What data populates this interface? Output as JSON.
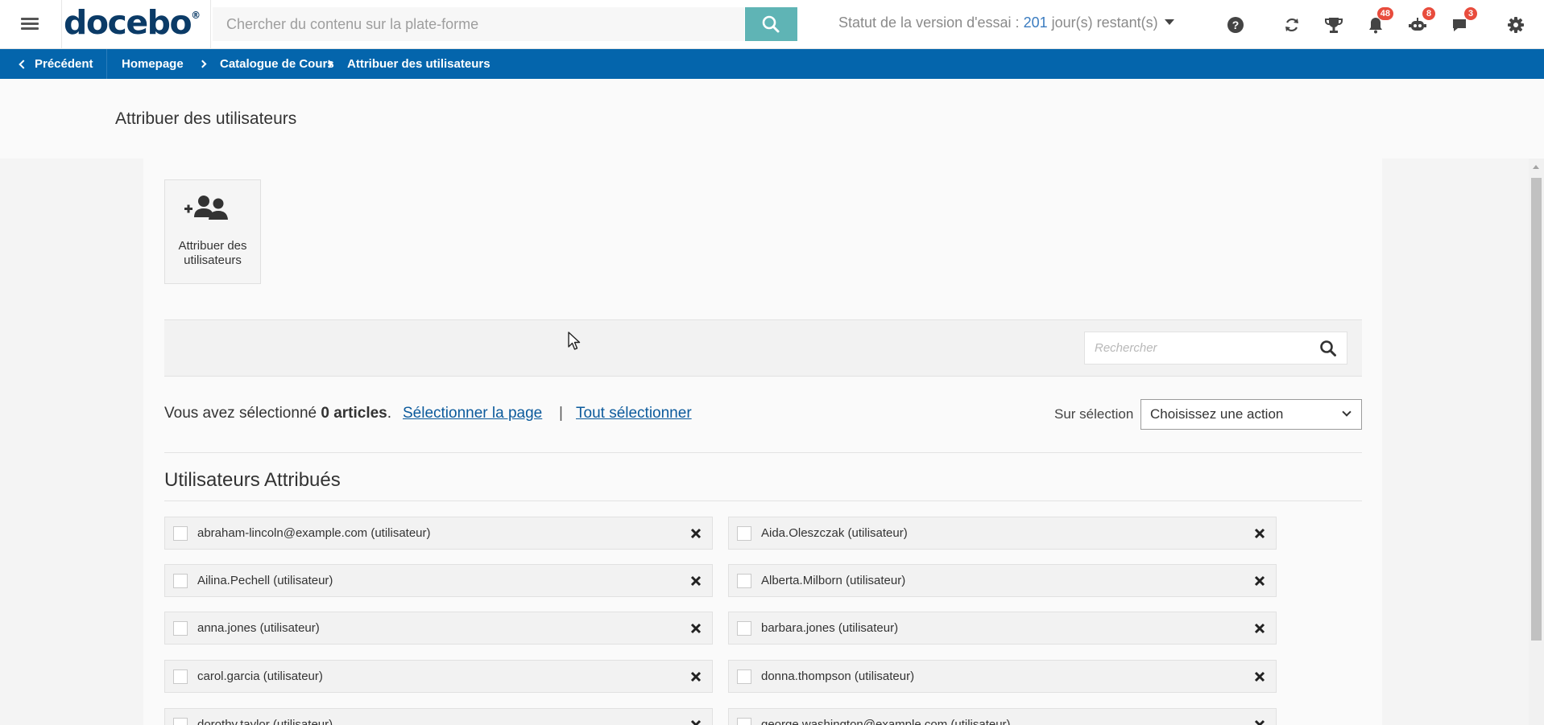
{
  "topbar": {
    "logo_text": "docebo",
    "logo_mark": "®",
    "search_placeholder": "Chercher du contenu sur la plate-forme",
    "trial_prefix": "Statut de la version d'essai : ",
    "trial_days": "201",
    "trial_suffix": " jour(s) restant(s)",
    "badges": {
      "notifications": "48",
      "assistant": "8",
      "messages": "3"
    },
    "icons": [
      "menu-icon",
      "search-icon",
      "help-icon",
      "sync-icon",
      "trophy-icon",
      "bell-icon",
      "robot-icon",
      "chat-icon",
      "gear-icon"
    ]
  },
  "breadcrumb": {
    "back_label": "Précédent",
    "items": [
      "Homepage",
      "Catalogue de Cours",
      "Attribuer des utilisateurs"
    ]
  },
  "page": {
    "title": "Attribuer des utilisateurs"
  },
  "tile": {
    "label_line1": "Attribuer des",
    "label_line2": "utilisateurs",
    "icon": "add-users-icon"
  },
  "filter": {
    "search_placeholder": "Rechercher"
  },
  "selection": {
    "prefix": "Vous avez sélectionné ",
    "count": "0 articles",
    "suffix": ".",
    "select_page": "Sélectionner la page",
    "separator": "|",
    "select_all": "Tout sélectionner",
    "on_selection_label": "Sur sélection",
    "action_value": "Choisissez une action"
  },
  "assigned": {
    "title": "Utilisateurs Attribués",
    "users": [
      "abraham-lincoln@example.com (utilisateur)",
      "Aida.Oleszczak (utilisateur)",
      "Ailina.Pechell (utilisateur)",
      "Alberta.Milborn (utilisateur)",
      "anna.jones (utilisateur)",
      "barbara.jones (utilisateur)",
      "carol.garcia (utilisateur)",
      "donna.thompson (utilisateur)",
      "dorothy.taylor (utilisateur)",
      "george.washington@example.com (utilisateur)"
    ]
  },
  "colors": {
    "brand_blue": "#0465ac",
    "search_button": "#5fb4b5",
    "badge_red": "#e84c3d",
    "link_blue": "#0b5a9c",
    "logo_navy": "#0b3b67"
  }
}
